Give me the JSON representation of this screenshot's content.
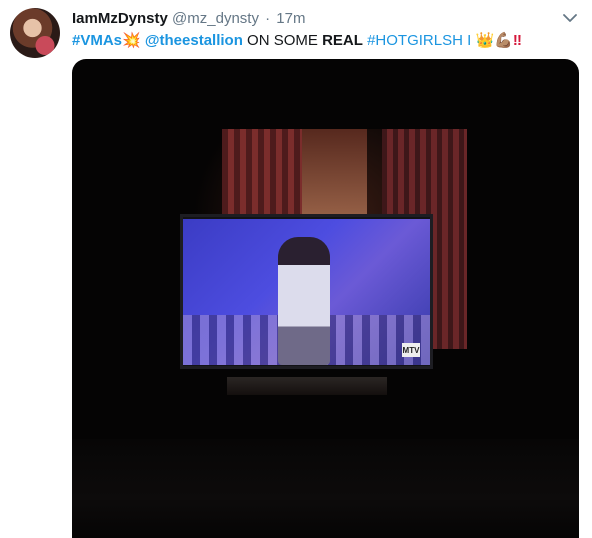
{
  "tweet": {
    "display_name": "IamMzDynsty",
    "handle": "@mz_dynsty",
    "separator": "·",
    "time": "17m",
    "text": {
      "hashtag_vmas": "#VMAs",
      "emoji_vmas": "💥",
      "mention": "@theestallion",
      "plain1": " ON SOME ",
      "bold": "REAL",
      "hashtag_hotgirl": " #HOTGIRLSH",
      "cursor": "I",
      "emoji_crown": "👑",
      "emoji_muscle": "💪🏽",
      "bangbang": "‼"
    }
  },
  "media": {
    "tv_logo_text": "MTV"
  },
  "icons": {
    "chevron": "chevron-down-icon",
    "avatar": "avatar"
  },
  "colors": {
    "link": "#1b95e0",
    "secondary_text": "#657786",
    "media_background": "#050404"
  }
}
